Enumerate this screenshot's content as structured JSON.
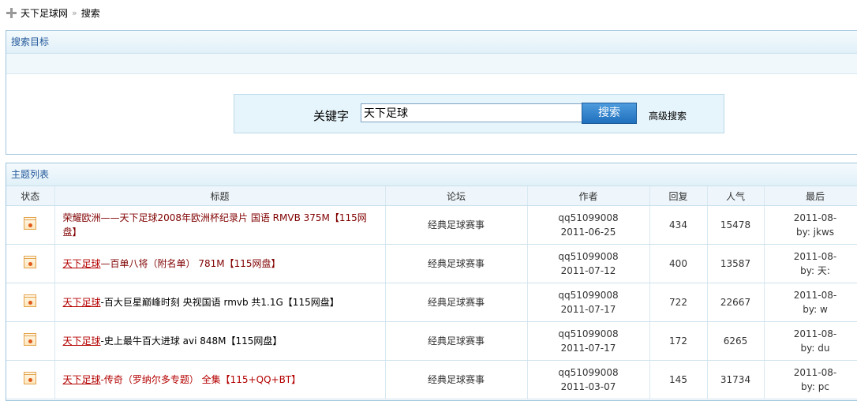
{
  "breadcrumb": {
    "site": "天下足球网",
    "separator": "»",
    "current": "搜索"
  },
  "search": {
    "panel_title": "搜索目标",
    "keyword_label": "关键字",
    "keyword_value": "天下足球",
    "button_label": "搜索",
    "advanced_label": "高级搜索"
  },
  "topics": {
    "panel_title": "主题列表",
    "columns": [
      "状态",
      "标题",
      "论坛",
      "作者",
      "回复",
      "人气",
      "最后"
    ],
    "rows": [
      {
        "title_hl": "",
        "title_rest": "荣耀欧洲——天下足球2008年欧洲杯纪录片 国语 RMVB 375M【115网盘】",
        "forum": "经典足球赛事",
        "author": "qq51099008",
        "date": "2011-06-25",
        "replies": "434",
        "views": "15478",
        "last_date": "2011-08-",
        "last_by": "by: jkws"
      },
      {
        "title_hl": "天下足球",
        "title_rest": "—百单八将（附名单） 781M【115网盘】",
        "forum": "经典足球赛事",
        "author": "qq51099008",
        "date": "2011-07-12",
        "replies": "400",
        "views": "13587",
        "last_date": "2011-08-",
        "last_by": "by: 天:"
      },
      {
        "title_hl": "天下足球",
        "title_rest": "-百大巨星巅峰时刻 央视国语 rmvb 共1.1G【115网盘】",
        "forum": "经典足球赛事",
        "author": "qq51099008",
        "date": "2011-07-17",
        "replies": "722",
        "views": "22667",
        "last_date": "2011-08-",
        "last_by": "by: w"
      },
      {
        "title_hl": "天下足球",
        "title_rest": "-史上最牛百大进球 avi 848M【115网盘】",
        "forum": "经典足球赛事",
        "author": "qq51099008",
        "date": "2011-07-17",
        "replies": "172",
        "views": "6265",
        "last_date": "2011-08-",
        "last_by": "by: du"
      },
      {
        "title_hl": "天下足球",
        "title_rest": "-传奇（罗纳尔多专题） 全集【115+QQ+BT】",
        "forum": "经典足球赛事",
        "author": "qq51099008",
        "date": "2011-03-07",
        "replies": "145",
        "views": "31734",
        "last_date": "2011-08-",
        "last_by": "by: pc"
      }
    ]
  }
}
